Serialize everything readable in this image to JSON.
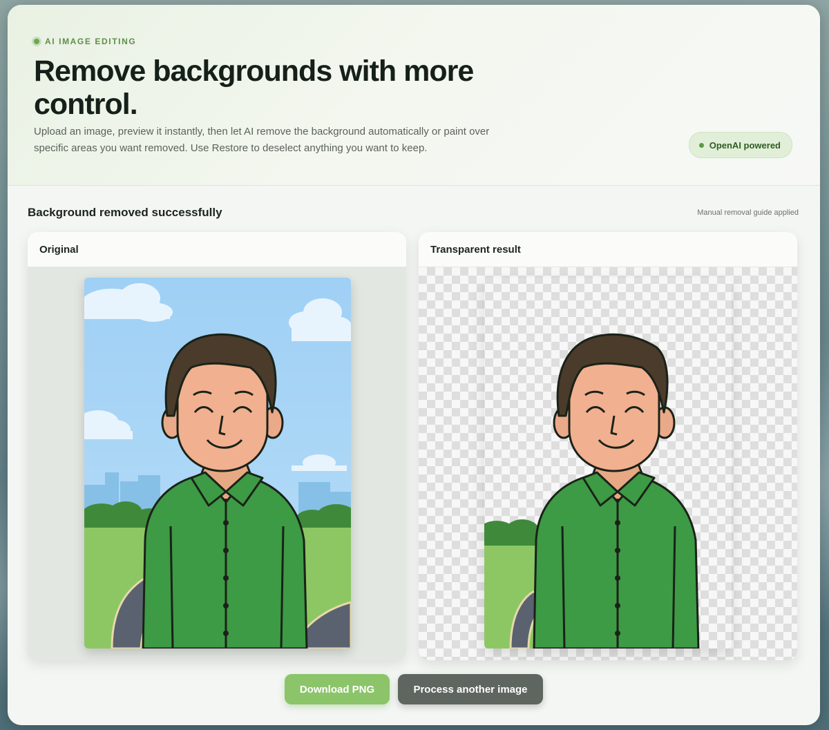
{
  "hero": {
    "eyebrow": "AI IMAGE EDITING",
    "title": "Remove backgrounds with more control.",
    "description": "Upload an image, preview it instantly, then let AI remove the background automatically or paint over specific areas you want removed. Use Restore to deselect anything you want to keep.",
    "badge": "OpenAI powered"
  },
  "result": {
    "status": "Background removed successfully",
    "note": "Manual removal guide applied",
    "original_label": "Original",
    "result_label": "Transparent result"
  },
  "actions": {
    "download_label": "Download PNG",
    "process_label": "Process another image"
  },
  "colors": {
    "accent": "#8cc46a",
    "secondary": "#5e665f",
    "shirt": "#3d9a45",
    "sky": "#9fd0f5"
  }
}
